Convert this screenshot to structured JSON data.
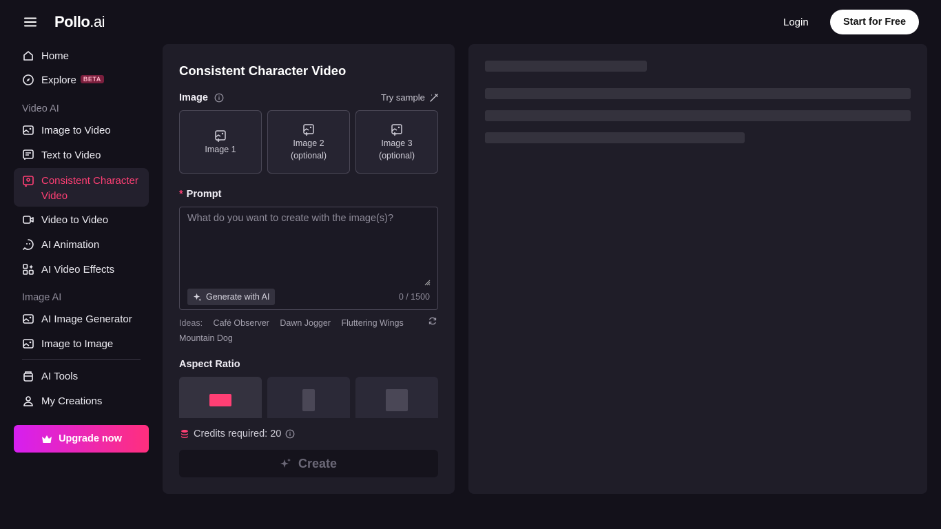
{
  "header": {
    "logo_main": "Pollo",
    "logo_suffix": ".ai",
    "login_label": "Login",
    "start_label": "Start for Free"
  },
  "sidebar": {
    "home": "Home",
    "explore": "Explore",
    "explore_badge": "BETA",
    "video_ai_label": "Video AI",
    "image_to_video": "Image to Video",
    "text_to_video": "Text to Video",
    "consistent_line1": "Consistent Character",
    "consistent_line2": "Video",
    "video_to_video": "Video to Video",
    "ai_animation": "AI Animation",
    "ai_video_effects": "AI Video Effects",
    "image_ai_label": "Image AI",
    "ai_image_generator": "AI Image Generator",
    "image_to_image": "Image to Image",
    "ai_tools": "AI Tools",
    "my_creations": "My Creations",
    "upgrade_label": "Upgrade now",
    "active_item": "Consistent Character Video"
  },
  "form": {
    "title": "Consistent Character Video",
    "image_label": "Image",
    "try_sample": "Try sample",
    "slots": [
      {
        "line1": "Image 1",
        "line2": ""
      },
      {
        "line1": "Image 2",
        "line2": "(optional)"
      },
      {
        "line1": "Image 3",
        "line2": "(optional)"
      }
    ],
    "prompt_required_mark": "*",
    "prompt_label": "Prompt",
    "prompt_placeholder": "What do you want to create with the image(s)?",
    "prompt_value": "",
    "generate_label": "Generate with AI",
    "char_counter": "0 / 1500",
    "ideas_label": "Ideas:",
    "ideas": [
      "Café Observer",
      "Dawn Jogger",
      "Fluttering Wings",
      "Mountain Dog"
    ],
    "aspect_ratio_label": "Aspect Ratio",
    "aspect_ratios_selected_index": 0,
    "credits_label": "Credits required: 20",
    "create_label": "Create"
  },
  "colors": {
    "accent": "#ff3f74",
    "upgrade_gradient_start": "#d61ff0",
    "upgrade_gradient_end": "#ff2f7d",
    "background": "#13111a",
    "panel": "#1f1d28"
  }
}
